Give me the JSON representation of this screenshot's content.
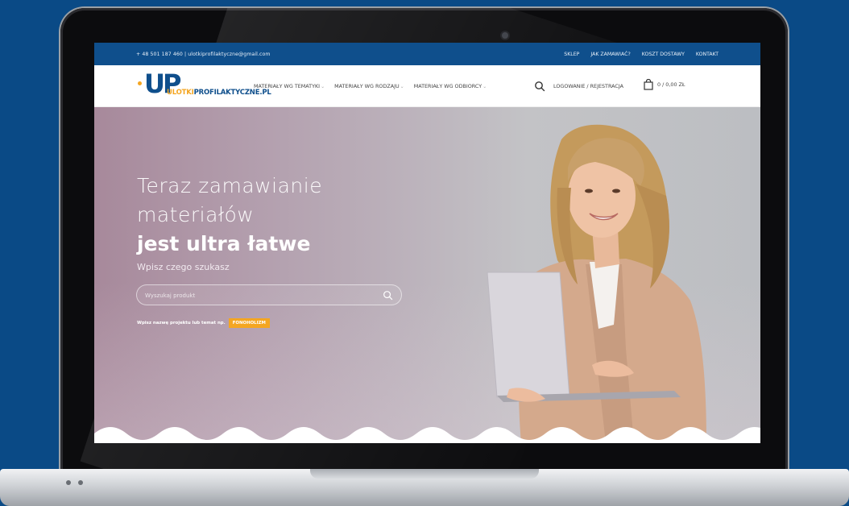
{
  "topbar": {
    "contact": "+ 48 501 187 460 | ulotkiprofilaktyczne@gmail.com",
    "links": [
      "SKLEP",
      "JAK ZAMAWIAĆ?",
      "KOSZT DOSTAWY",
      "KONTAKT"
    ]
  },
  "header": {
    "logo_mark": "UP",
    "logo_text_accent": "ULOTKI",
    "logo_text_main": "PROFILAKTYCZNE.PL",
    "nav": [
      "MATERIAŁY WG TEMATYKI",
      "MATERIAŁY WG RODZAJU",
      "MATERIAŁY WG ODBIORCY"
    ],
    "login": "LOGOWANIE / REJESTRACJA",
    "cart_amount": "0 / 0,00 ZŁ"
  },
  "hero": {
    "line1": "Teraz zamawianie",
    "line2": "materiałów",
    "line3": "jest ultra łatwe",
    "subhead": "Wpisz czego szukasz",
    "search_placeholder": "Wyszukaj produkt",
    "hint": "Wpisz nazwę projektu lub temat np.",
    "tag": "FONOHOLIZM"
  },
  "colors": {
    "brand_blue": "#0f4f8c",
    "accent_orange": "#f4a622",
    "page_background": "#0a4a86"
  }
}
